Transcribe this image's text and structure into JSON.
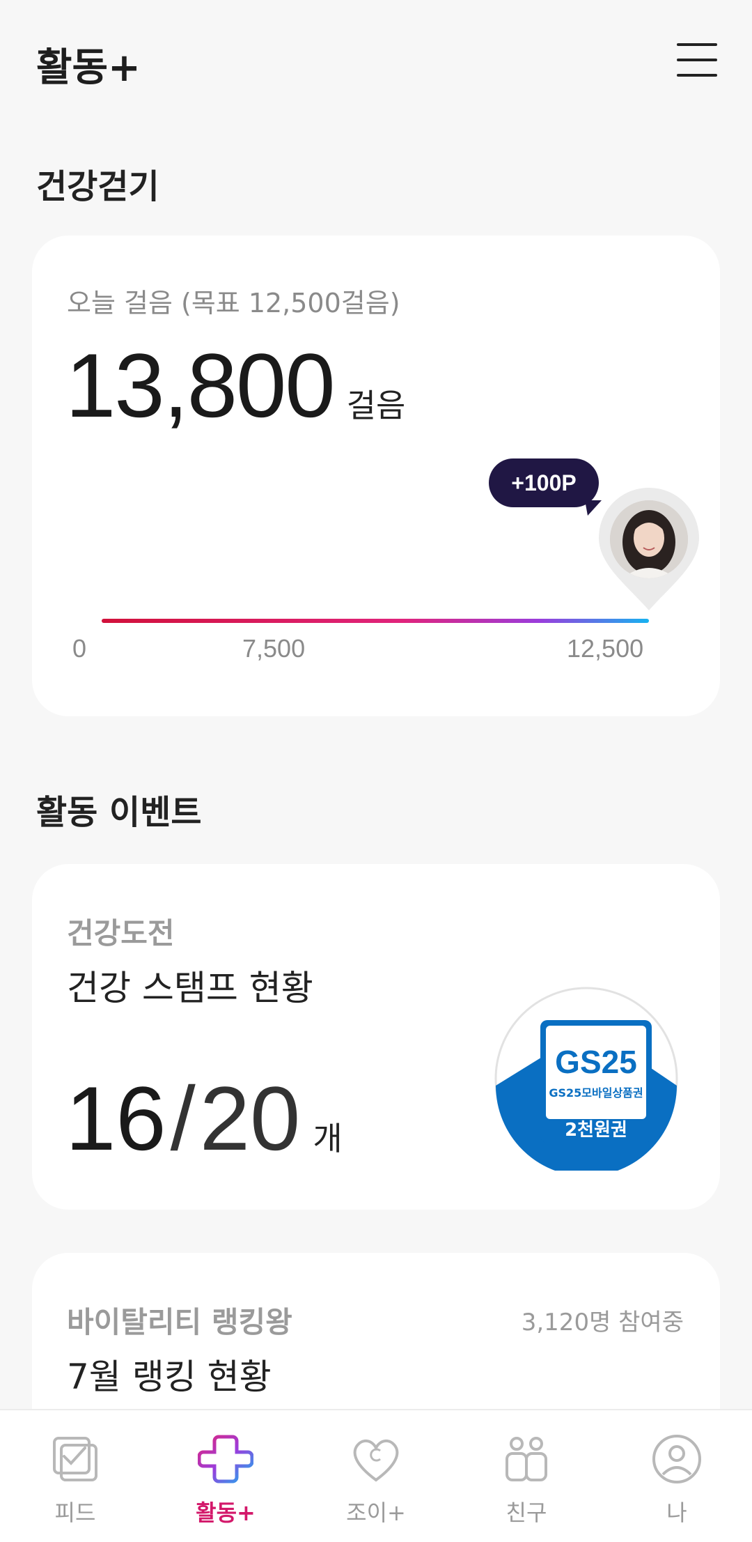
{
  "header": {
    "title": "활동+",
    "menu_icon": "hamburger-menu-icon"
  },
  "walking": {
    "section_title": "건강걷기",
    "label": "오늘 걸음 (목표 12,500걸음)",
    "steps": "13,800",
    "steps_unit": "걸음",
    "goal_steps": 12500,
    "reward_bubble": "+100P",
    "scale": [
      "0",
      "7,500",
      "12,500"
    ],
    "progress_fraction": 1.0
  },
  "events": {
    "section_title": "활동 이벤트",
    "stamp_card": {
      "category": "건강도전",
      "title": "건강 스탬프 현황",
      "done": "16",
      "slash": "/",
      "total": "20",
      "unit": "개",
      "coupon_brand": "GS25",
      "coupon_name": "GS25모바일상품권",
      "coupon_value": "2천원권"
    },
    "ranking_card": {
      "category": "바이탈리티 랭킹왕",
      "participants": "3,120명 참여중",
      "title": "7월 랭킹 현황"
    }
  },
  "tabs": [
    {
      "label": "피드",
      "icon": "feed-check-icon",
      "active": false
    },
    {
      "label": "활동+",
      "icon": "activity-plus-icon",
      "active": true
    },
    {
      "label": "조이+",
      "icon": "heart-joy-icon",
      "active": false
    },
    {
      "label": "친구",
      "icon": "friends-icon",
      "active": false
    },
    {
      "label": "나",
      "icon": "profile-icon",
      "active": false
    }
  ],
  "colors": {
    "accent": "#d3186a",
    "bubble": "#201744",
    "gradient_start": "#d1113b",
    "gradient_end": "#17b2f0",
    "coupon_blue": "#0a6fc2"
  }
}
